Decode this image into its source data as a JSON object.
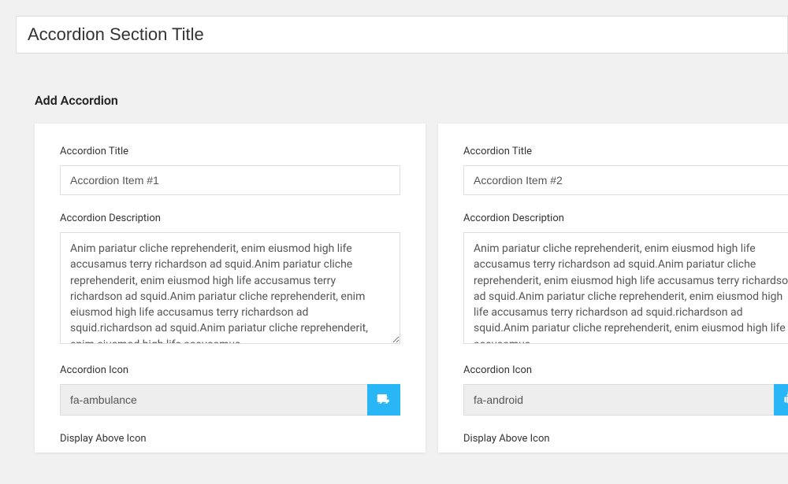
{
  "title_input": {
    "value": "Accordion Section Title"
  },
  "section_heading": "Add Accordion",
  "labels": {
    "title": "Accordion Title",
    "description": "Accordion Description",
    "icon": "Accordion Icon",
    "display_above": "Display Above Icon"
  },
  "items": [
    {
      "title": "Accordion Item #1",
      "description": "Anim pariatur cliche reprehenderit, enim eiusmod high life accusamus terry richardson ad squid.Anim pariatur cliche reprehenderit, enim eiusmod high life accusamus terry richardson ad squid.Anim pariatur cliche reprehenderit, enim eiusmod high life accusamus terry richardson ad squid.richardson ad squid.Anim pariatur cliche reprehenderit, enim eiusmod high life accusamus",
      "icon": "fa-ambulance"
    },
    {
      "title": "Accordion Item #2",
      "description": "Anim pariatur cliche reprehenderit, enim eiusmod high life accusamus terry richardson ad squid.Anim pariatur cliche reprehenderit, enim eiusmod high life accusamus terry richardson ad squid.Anim pariatur cliche reprehenderit, enim eiusmod high life accusamus terry richardson ad squid.richardson ad squid.Anim pariatur cliche reprehenderit, enim eiusmod high life accusamus",
      "icon": "fa-android"
    }
  ]
}
